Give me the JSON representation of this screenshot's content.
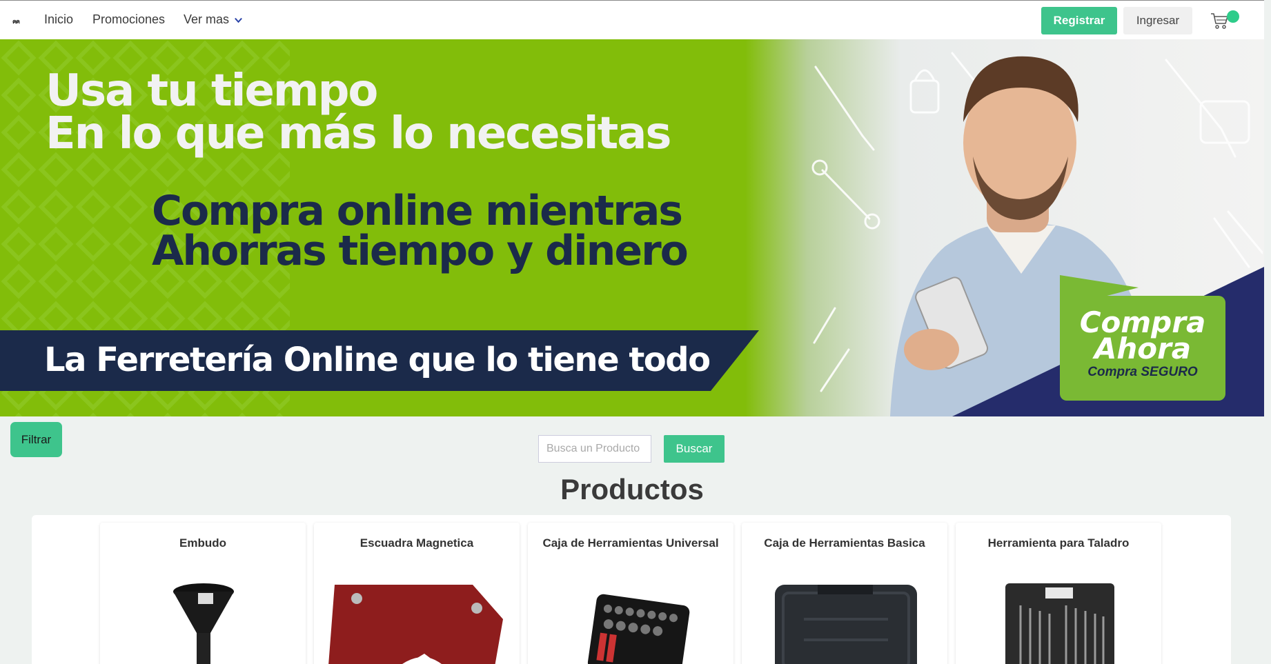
{
  "nav": {
    "logo": "ฅฅ",
    "links": [
      "Inicio",
      "Promociones",
      "Ver mas"
    ],
    "register": "Registrar",
    "login": "Ingresar"
  },
  "hero": {
    "line1": "Usa tu tiempo",
    "line2": "En lo que más lo necesitas",
    "line3": "Compra online mientras",
    "line4": "Ahorras tiempo y dinero",
    "band": "La Ferretería Online que lo tiene todo",
    "cta_title1": "Compra",
    "cta_title2": "Ahora",
    "cta_sub": "Compra SEGURO"
  },
  "filter": {
    "label": "Filtrar"
  },
  "search": {
    "placeholder": "Busca un Producto",
    "button": "Buscar"
  },
  "products": {
    "title": "Productos",
    "items": [
      {
        "name": "Embudo"
      },
      {
        "name": "Escuadra Magnetica"
      },
      {
        "name": "Caja de Herramientas Universal"
      },
      {
        "name": "Caja de Herramientas Basica"
      },
      {
        "name": "Herramienta para Taladro"
      }
    ]
  },
  "colors": {
    "primary": "#3ec48c",
    "hero_green": "#82bd0a",
    "navy": "#1b2a4a"
  },
  "icons": [
    "chevron-down-icon",
    "cart-icon"
  ]
}
